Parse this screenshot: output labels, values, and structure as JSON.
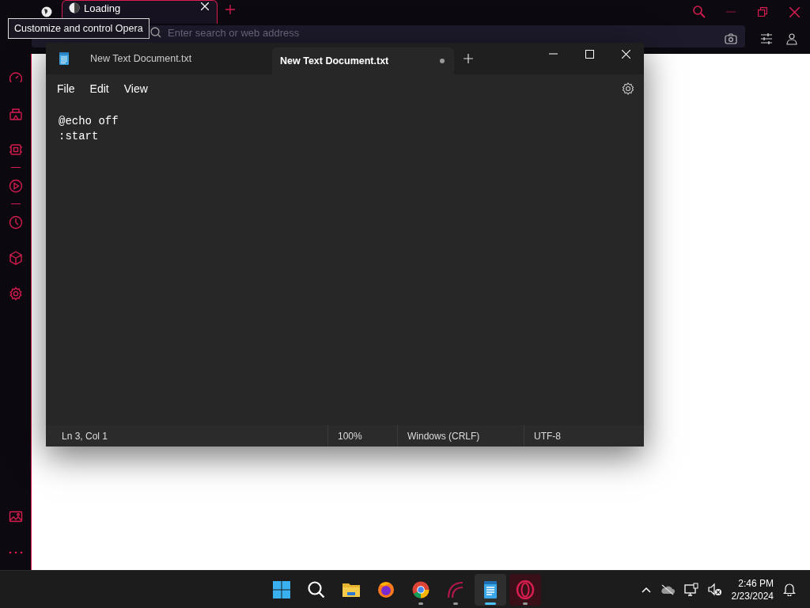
{
  "browser": {
    "tabs": [
      {
        "title": "Loading",
        "selected": true
      }
    ],
    "tooltip": "Customize and control Opera",
    "address": {
      "placeholder": "Enter search or web address"
    }
  },
  "notepad": {
    "tabs": [
      {
        "title": "New Text Document.txt",
        "selected": false,
        "unsaved": false
      },
      {
        "title": "New Text Document.txt",
        "selected": true,
        "unsaved": true
      }
    ],
    "menu": [
      "File",
      "Edit",
      "View"
    ],
    "lines": [
      "@echo off",
      ":start"
    ],
    "status_bar": [
      "Ln 3, Col 1",
      "100%",
      "Windows (CRLF)",
      "UTF-8"
    ]
  },
  "taskbar": {
    "apps": [
      {
        "kind": "start",
        "running": false,
        "selected": false
      },
      {
        "kind": "search",
        "running": false,
        "selected": false
      },
      {
        "kind": "folder",
        "running": false,
        "selected": false
      },
      {
        "kind": "firefox",
        "running": false,
        "selected": false
      },
      {
        "kind": "chrome",
        "running": true,
        "selected": false
      },
      {
        "kind": "arc",
        "running": true,
        "selected": false
      },
      {
        "kind": "notepad",
        "running": true,
        "selected": true
      },
      {
        "kind": "opera",
        "running": true,
        "selected": false
      }
    ],
    "time": "2:46 PM",
    "date": "2/23/2024"
  }
}
